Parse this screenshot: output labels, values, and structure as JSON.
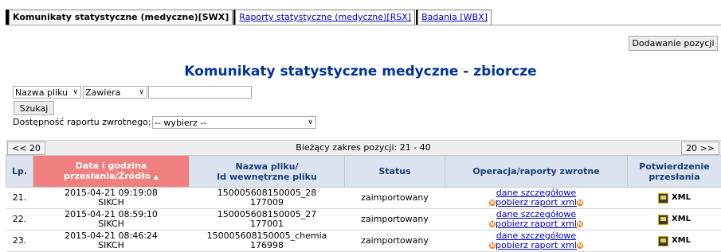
{
  "tabs": [
    {
      "label": "Komunikaty statystyczne (medyczne)[SWX]",
      "active": true
    },
    {
      "label": "Raporty statystyczne (medyczne)[RSX]",
      "active": false
    },
    {
      "label": "Badania [WBX]",
      "active": false
    }
  ],
  "toolbar": {
    "add_label": "Dodawanie pozycji"
  },
  "page_title": "Komunikaty statystyczne medyczne - zbiorcze",
  "filter": {
    "field_select": "Nazwa pliku",
    "op_select": "Zawiera",
    "value": "",
    "search_label": "Szukaj",
    "return_label": "Dostępność raportu zwrotnego:",
    "return_select": "-- wybierz --"
  },
  "pager": {
    "prev": "<< 20",
    "info": "Bieżący zakres pozycji: 21 - 40",
    "next": "20 >>"
  },
  "table": {
    "headers": {
      "lp": "Lp.",
      "date_1": "Data i godzina",
      "date_2": "przesłania/Źródło",
      "date_sort_icon": "▲",
      "file_1": "Nazwa pliku/",
      "file_2": "Id wewnętrzne pliku",
      "status": "Status",
      "ops": "Operacja/raporty zwrotne",
      "confirm_1": "Potwierdzenie",
      "confirm_2": "przesłania"
    },
    "rows": [
      {
        "lp": "21.",
        "date": "2015-04-21 09:19:08",
        "source": "SIKCH",
        "file": "150005608150005_28",
        "id": "177009",
        "status": "zaimportowany",
        "op1": "dane szczegółowe",
        "op2": "pobierz raport xml",
        "badge": "N",
        "xml": "XML"
      },
      {
        "lp": "22.",
        "date": "2015-04-21 08:59:10",
        "source": "SIKCH",
        "file": "150005608150005_27",
        "id": "177001",
        "status": "zaimportowany",
        "op1": "dane szczegółowe",
        "op2": "pobierz raport xml",
        "badge": "N",
        "xml": "XML"
      },
      {
        "lp": "23.",
        "date": "2015-04-21 08:46:24",
        "source": "SIKCH",
        "file": "150005608150005_chemia",
        "id": "176998",
        "status": "zaimportowany",
        "op1": "dane szczegółowe",
        "op2": "pobierz raport xml",
        "badge": "N",
        "xml": "XML"
      }
    ]
  },
  "colors": {
    "header_bg": "#dbe3f0",
    "header_text": "#1a3c78",
    "sorted_header_bg": "#f08080",
    "title": "#003399",
    "link": "#0000cc",
    "badge": "#f07a10"
  },
  "icons": {
    "download_badge": "orange-circle-icon",
    "confirm": "computer-icon"
  }
}
